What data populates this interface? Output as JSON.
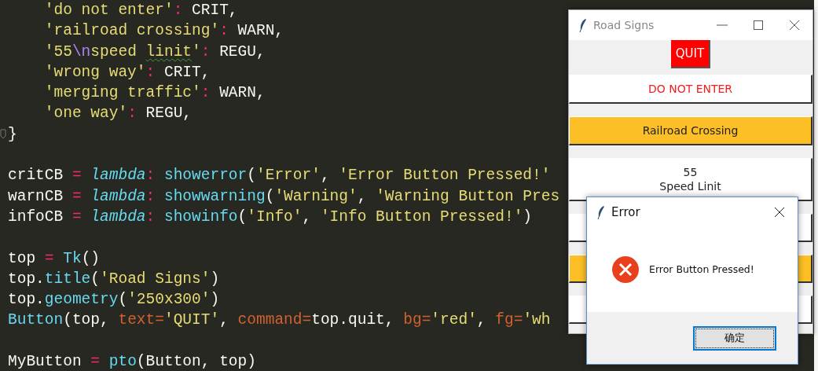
{
  "editor": {
    "lines": [
      {
        "kind": "code",
        "tokens": [
          {
            "text": "    'do not enter'",
            "kind": "string"
          },
          {
            "text": ": ",
            "kind": "op"
          },
          {
            "text": "CRIT,",
            "kind": "plain"
          }
        ]
      },
      {
        "kind": "code",
        "tokens": [
          {
            "text": "    'railroad crossing'",
            "kind": "string"
          },
          {
            "text": ": ",
            "kind": "op"
          },
          {
            "text": "WARN,",
            "kind": "plain"
          }
        ]
      },
      {
        "kind": "code",
        "tokens": [
          {
            "text": "    '55",
            "kind": "string"
          },
          {
            "text": "\\n",
            "kind": "escape"
          },
          {
            "text": "speed ",
            "kind": "string"
          },
          {
            "text": "linit",
            "kind": "string",
            "flagged": true
          },
          {
            "text": "'",
            "kind": "string"
          },
          {
            "text": ": ",
            "kind": "op"
          },
          {
            "text": "REGU,",
            "kind": "plain"
          }
        ]
      },
      {
        "kind": "code",
        "tokens": [
          {
            "text": "    'wrong way'",
            "kind": "string"
          },
          {
            "text": ": ",
            "kind": "op"
          },
          {
            "text": "CRIT,",
            "kind": "plain"
          }
        ]
      },
      {
        "kind": "code",
        "tokens": [
          {
            "text": "    'merging traffic'",
            "kind": "string"
          },
          {
            "text": ": ",
            "kind": "op"
          },
          {
            "text": "WARN,",
            "kind": "plain"
          }
        ]
      },
      {
        "kind": "code",
        "tokens": [
          {
            "text": "    'one way'",
            "kind": "string"
          },
          {
            "text": ": ",
            "kind": "op"
          },
          {
            "text": "REGU,",
            "kind": "plain"
          }
        ]
      },
      {
        "kind": "code",
        "folded_end": true,
        "tokens": [
          {
            "text": "}",
            "kind": "plain"
          }
        ]
      },
      {
        "kind": "blank"
      },
      {
        "kind": "code",
        "tokens": [
          {
            "text": "critCB ",
            "kind": "plain"
          },
          {
            "text": "= ",
            "kind": "op"
          },
          {
            "text": "lambda",
            "kind": "keyword"
          },
          {
            "text": ": ",
            "kind": "op"
          },
          {
            "text": "showerror",
            "kind": "func"
          },
          {
            "text": "(",
            "kind": "plain"
          },
          {
            "text": "'Error'",
            "kind": "string"
          },
          {
            "text": ", ",
            "kind": "plain"
          },
          {
            "text": "'Error Button Pressed!'",
            "kind": "string"
          }
        ]
      },
      {
        "kind": "code",
        "tokens": [
          {
            "text": "warnCB ",
            "kind": "plain"
          },
          {
            "text": "= ",
            "kind": "op"
          },
          {
            "text": "lambda",
            "kind": "keyword"
          },
          {
            "text": ": ",
            "kind": "op"
          },
          {
            "text": "showwarning",
            "kind": "func"
          },
          {
            "text": "(",
            "kind": "plain"
          },
          {
            "text": "'Warning'",
            "kind": "string"
          },
          {
            "text": ", ",
            "kind": "plain"
          },
          {
            "text": "'Warning Button Pres",
            "kind": "string"
          }
        ]
      },
      {
        "kind": "code",
        "tokens": [
          {
            "text": "infoCB ",
            "kind": "plain"
          },
          {
            "text": "= ",
            "kind": "op"
          },
          {
            "text": "lambda",
            "kind": "keyword"
          },
          {
            "text": ": ",
            "kind": "op"
          },
          {
            "text": "showinfo",
            "kind": "func"
          },
          {
            "text": "(",
            "kind": "plain"
          },
          {
            "text": "'Info'",
            "kind": "string"
          },
          {
            "text": ", ",
            "kind": "plain"
          },
          {
            "text": "'Info Button Pressed!'",
            "kind": "string"
          },
          {
            "text": ")",
            "kind": "plain"
          }
        ]
      },
      {
        "kind": "blank"
      },
      {
        "kind": "code",
        "tokens": [
          {
            "text": "top ",
            "kind": "plain"
          },
          {
            "text": "= ",
            "kind": "op"
          },
          {
            "text": "Tk",
            "kind": "func"
          },
          {
            "text": "()",
            "kind": "plain"
          }
        ]
      },
      {
        "kind": "code",
        "tokens": [
          {
            "text": "top.",
            "kind": "plain"
          },
          {
            "text": "title",
            "kind": "func"
          },
          {
            "text": "(",
            "kind": "plain"
          },
          {
            "text": "'Road Signs'",
            "kind": "string"
          },
          {
            "text": ")",
            "kind": "plain"
          }
        ]
      },
      {
        "kind": "code",
        "tokens": [
          {
            "text": "top.",
            "kind": "plain"
          },
          {
            "text": "geometry",
            "kind": "func"
          },
          {
            "text": "(",
            "kind": "plain"
          },
          {
            "text": "'250x300'",
            "kind": "string"
          },
          {
            "text": ")",
            "kind": "plain"
          }
        ]
      },
      {
        "kind": "code",
        "tokens": [
          {
            "text": "Button",
            "kind": "func"
          },
          {
            "text": "(top, ",
            "kind": "plain"
          },
          {
            "text": "text=",
            "kind": "param"
          },
          {
            "text": "'QUIT'",
            "kind": "string"
          },
          {
            "text": ", ",
            "kind": "plain"
          },
          {
            "text": "command=",
            "kind": "param"
          },
          {
            "text": "top.quit, ",
            "kind": "plain"
          },
          {
            "text": "bg=",
            "kind": "param"
          },
          {
            "text": "'red'",
            "kind": "string"
          },
          {
            "text": ", ",
            "kind": "plain"
          },
          {
            "text": "fg=",
            "kind": "param"
          },
          {
            "text": "'wh",
            "kind": "string"
          }
        ]
      },
      {
        "kind": "blank"
      },
      {
        "kind": "code",
        "tokens": [
          {
            "text": "MyButton ",
            "kind": "plain"
          },
          {
            "text": "= ",
            "kind": "op"
          },
          {
            "text": "pto",
            "kind": "func"
          },
          {
            "text": "(Button, top)",
            "kind": "plain"
          }
        ]
      }
    ]
  },
  "road_signs_window": {
    "title": "Road Signs",
    "quit_button": "QUIT",
    "sign_buttons": [
      {
        "kind": "crit",
        "label_lines": [
          "DO NOT ENTER"
        ]
      },
      {
        "kind": "warn",
        "label_lines": [
          "Railroad Crossing"
        ]
      },
      {
        "kind": "regu",
        "label_lines": [
          "55",
          "Speed Linit"
        ]
      },
      {
        "kind": "crit"
      },
      {
        "kind": "warn"
      },
      {
        "kind": "regu"
      }
    ]
  },
  "error_dialog": {
    "title": "Error",
    "message": "Error Button Pressed!",
    "button": {
      "label": "确定",
      "focused": true
    }
  }
}
